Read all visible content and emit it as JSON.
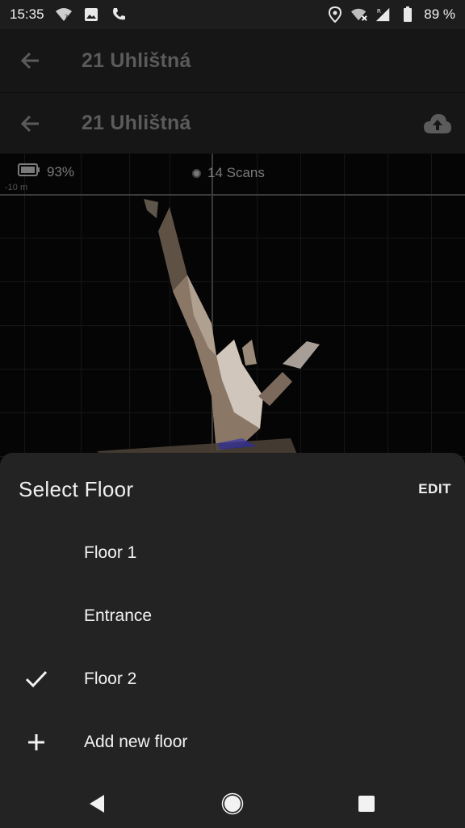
{
  "status_bar": {
    "time": "15:35",
    "battery_percent": "89 %",
    "icons_left": [
      "wifi-question-icon",
      "image-icon",
      "wifi-call-icon"
    ],
    "icons_right": [
      "location-icon",
      "wifi-off-icon",
      "signal-roaming-icon",
      "battery-icon"
    ]
  },
  "toolbar_primary": {
    "title": "21 Uhlištná",
    "back_icon": "arrow-back-icon"
  },
  "toolbar_secondary": {
    "title": "21 Uhlištná",
    "back_icon": "arrow-back-icon",
    "action_icon": "cloud-upload-icon"
  },
  "viewport": {
    "battery_level": "93%",
    "scans": "14 Scans",
    "axis_label": "-10 m"
  },
  "sheet": {
    "title": "Select Floor",
    "edit_label": "EDIT",
    "items": [
      {
        "label": "Floor 1",
        "selected": false,
        "icon": ""
      },
      {
        "label": "Entrance",
        "selected": false,
        "icon": ""
      },
      {
        "label": "Floor 2",
        "selected": true,
        "icon": "checkmark-icon"
      },
      {
        "label": "Add new floor",
        "selected": false,
        "icon": "plus-icon"
      }
    ]
  },
  "nav_bar": {
    "buttons": [
      "back-triangle-icon",
      "home-circle-icon",
      "recents-square-icon"
    ]
  },
  "colors": {
    "sheet_bg": "#232323",
    "toolbar_bg": "#161616",
    "dim_text": "#5b5b5b"
  }
}
